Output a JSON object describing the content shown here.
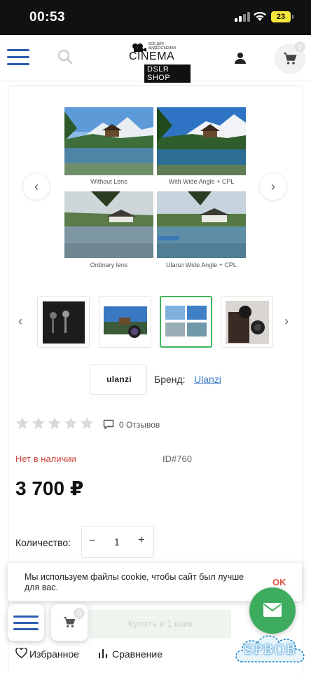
{
  "status_bar": {
    "time": "00:53",
    "battery": "23"
  },
  "header": {
    "logo": {
      "tagline": "ВСЁ ДЛЯ ВИДЕОСЪЁМКИ",
      "name": "CINEMA",
      "shop": "DSLR SHOP"
    },
    "cart_count": "0",
    "icons": [
      "hamburger-menu-icon",
      "search-icon",
      "user-icon",
      "cart-icon"
    ]
  },
  "gallery": {
    "captions": [
      "Without Lens",
      "With Wide Angle + CPL",
      "Ordinary lens",
      "Ulanzi Wide Angle + CPL"
    ],
    "prev": "‹",
    "next": "›",
    "thumbs_prev": "‹",
    "thumbs_next": "›",
    "active_thumb_index": 2,
    "thumbs_count": 4
  },
  "brand": {
    "logo_text": "ulanzi",
    "label": "Бренд:",
    "name": "Ulanzi"
  },
  "rating": {
    "stars_filled": 0,
    "stars_total": 5,
    "reviews": "0 Отзывов"
  },
  "product": {
    "stock": "Нет в наличии",
    "sku": "ID#760",
    "price": "3 700 ₽"
  },
  "quantity": {
    "label": "Количество:",
    "minus": "−",
    "value": "1",
    "plus": "+"
  },
  "cookie": {
    "text": "Мы используем файлы cookie, чтобы сайт был лучше для вас.",
    "ok": "OK"
  },
  "buy_button": "Купить в 1 клик",
  "floating": {
    "cart_count": "0"
  },
  "watermark": "SPBOB",
  "bottom_links": {
    "favorites": "Избранное",
    "compare": "Сравнение"
  },
  "colors": {
    "accent_blue": "#2a5db0",
    "green": "#3dac5f",
    "out_of_stock": "#c9453d",
    "link": "#3b7ac3"
  }
}
